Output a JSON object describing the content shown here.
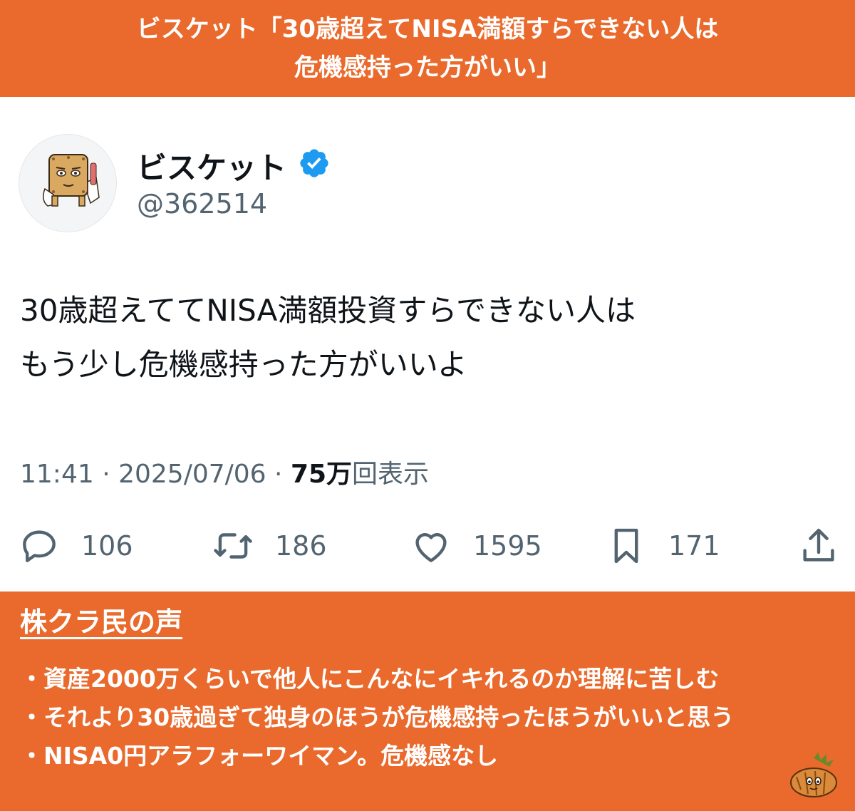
{
  "header": {
    "line1": "ビスケット「30歳超えてNISA満額すらできない人は",
    "line2": "危機感持った方がいい」"
  },
  "tweet": {
    "avatar_icon": "biscuit-character-icon",
    "name": "ビスケット",
    "verified_icon": "verified-badge-icon",
    "handle": "@362514",
    "text_line1": "30歳超えててNISA満額投資すらできない人は",
    "text_line2": "もう少し危機感持った方がいいよ",
    "time": "11:41",
    "date": "2025/07/06",
    "views_number": "75万",
    "views_label": "回表示",
    "actions": [
      {
        "icon": "reply-icon",
        "count": "106"
      },
      {
        "icon": "retweet-icon",
        "count": "186"
      },
      {
        "icon": "like-icon",
        "count": "1595"
      },
      {
        "icon": "bookmark-icon",
        "count": "171"
      },
      {
        "icon": "share-icon",
        "count": ""
      }
    ]
  },
  "footer": {
    "title": "株クラ民の声",
    "comments": [
      "・資産2000万くらいで他人にこんなにイキれるのか理解に苦しむ",
      "・それより30歳過ぎて独身のほうが危機感持ったほうがいいと思う",
      "・NISA0円アラフォーワイマン。危機感なし"
    ],
    "mascot_icon": "mascot-icon"
  },
  "colors": {
    "accent": "#e96a2c",
    "verified": "#1d9bf0",
    "secondary_text": "#536471",
    "primary_text": "#0f1419"
  }
}
